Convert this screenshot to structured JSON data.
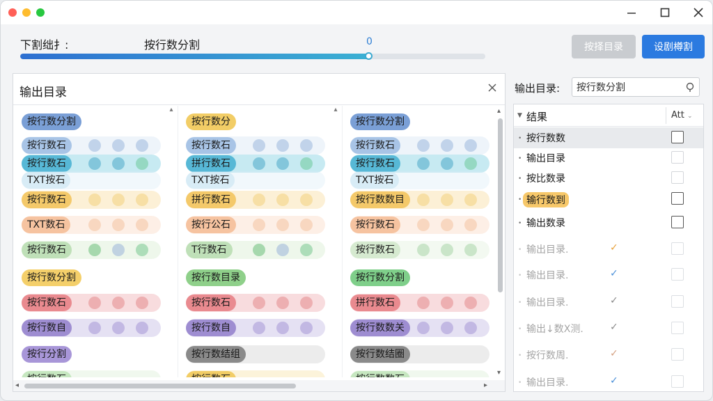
{
  "window": {
    "controls": [
      "close",
      "minimize",
      "zoom"
    ]
  },
  "top": {
    "label": "下割绌扌:",
    "value": "按行数分割",
    "percent": "0",
    "progress_fraction": 0.75,
    "btn_disabled": "按择目录",
    "btn_primary": "设剧樽割"
  },
  "panel": {
    "title": "输出目录",
    "columns": [
      {
        "rows": [
          {
            "label": "按行数分割",
            "pill": "#7a9fd6",
            "band": null,
            "dots": []
          },
          {
            "label": "按行数石",
            "pill": "#a8c4e6",
            "band": "#cfe0f2",
            "dots": [
              "#9cb8dc",
              "#9cb8dc",
              "#9cb8dc"
            ]
          },
          {
            "label": "按行数石",
            "pill": "#57b8d6",
            "band": "#5fc2db",
            "dots": [
              "#4aa8c8",
              "#4aa8c8",
              "#6cc99a"
            ]
          },
          {
            "label": "TXT按石",
            "pill": "#d8ecf6",
            "band": "#d6ebf5",
            "dots": []
          },
          {
            "label": "按行数石",
            "pill": "#f4c96a",
            "band": "#f7d58a",
            "dots": [
              "#f3d27d",
              "#f3d27d",
              "#f3d27d"
            ]
          },
          {
            "label": "TXT数石",
            "pill": "#f6c3a0",
            "band": "#f8d2b8",
            "dots": [
              "#f4c3a0",
              "#f4c3a0",
              "#f4c3a0"
            ]
          },
          {
            "label": "按行数石",
            "pill": "#bfe0b8",
            "band": "#cfe8c6",
            "dots": [
              "#6cc07a",
              "#9ab4d8",
              "#78c890"
            ]
          },
          {
            "label": "按行数分割",
            "pill": "#f4cf6a",
            "band": null,
            "dots": []
          },
          {
            "label": "按行数石",
            "pill": "#e98a8f",
            "band": "#eb9aa0",
            "dots": [
              "#e48a8c",
              "#e48a8c",
              "#e48a8c"
            ]
          },
          {
            "label": "按行数自",
            "pill": "#9e8dd1",
            "band": "#b5a8dc",
            "dots": [
              "#a597d6",
              "#a597d6",
              "#a597d6"
            ]
          },
          {
            "label": "按行分割",
            "pill": "#a896d8",
            "band": null,
            "dots": []
          },
          {
            "label": "按行数石",
            "pill": "#c6e7c0",
            "band": "#d4eccf",
            "dots": []
          }
        ]
      },
      {
        "rows": [
          {
            "label": "按行数分",
            "pill": "#f2cd66",
            "band": null,
            "dots": []
          },
          {
            "label": "按行数石",
            "pill": "#a8c4e6",
            "band": "#cfe0f2",
            "dots": [
              "#9cb8dc",
              "#9cb8dc",
              "#9cb8dc"
            ]
          },
          {
            "label": "拼行数石",
            "pill": "#57b8d6",
            "band": "#5fc2db",
            "dots": [
              "#4aa8c8",
              "#4aa8c8",
              "#6cc99a"
            ]
          },
          {
            "label": "TXT按石",
            "pill": "#d8ecf6",
            "band": "#d6ebf5",
            "dots": []
          },
          {
            "label": "拼行数石",
            "pill": "#f4c96a",
            "band": "#f7d58a",
            "dots": [
              "#f3d27d",
              "#f3d27d",
              "#f3d27d"
            ]
          },
          {
            "label": "按行公石",
            "pill": "#f6c3a0",
            "band": "#f8d2b8",
            "dots": [
              "#f4c3a0",
              "#f4c3a0",
              "#f4c3a0"
            ]
          },
          {
            "label": "T行数石",
            "pill": "#bfe0b8",
            "band": "#cfe8c6",
            "dots": [
              "#6cc07a",
              "#9ab4d8",
              "#78c890"
            ]
          },
          {
            "label": "按行数目录",
            "pill": "#8fd08a",
            "band": null,
            "dots": []
          },
          {
            "label": "按行数石",
            "pill": "#e98a8f",
            "band": "#eb9aa0",
            "dots": [
              "#e48a8c",
              "#e48a8c",
              "#e48a8c"
            ]
          },
          {
            "label": "按行数自",
            "pill": "#9e8dd1",
            "band": "#b5a8dc",
            "dots": [
              "#a597d6",
              "#a597d6",
              "#a597d6"
            ]
          },
          {
            "label": "按行数结组",
            "pill": "#8a8a8a",
            "band": "#c8c8c8",
            "dots": []
          },
          {
            "label": "按行数石",
            "pill": "#f2cd66",
            "band": "#f5dc96",
            "dots": []
          }
        ]
      },
      {
        "rows": [
          {
            "label": "按行数分割",
            "pill": "#7a9fd6",
            "band": null,
            "dots": []
          },
          {
            "label": "按行数石",
            "pill": "#a8c4e6",
            "band": "#cfe0f2",
            "dots": [
              "#9cb8dc",
              "#9cb8dc",
              "#9cb8dc"
            ]
          },
          {
            "label": "按行数石",
            "pill": "#57b8d6",
            "band": "#5fc2db",
            "dots": [
              "#4aa8c8",
              "#4aa8c8",
              "#6cc99a"
            ]
          },
          {
            "label": "TXT按石",
            "pill": "#d8ecf6",
            "band": "#d6ebf5",
            "dots": []
          },
          {
            "label": "按行数数目",
            "pill": "#f4c96a",
            "band": "#f7d58a",
            "dots": [
              "#f3d27d",
              "#f3d27d",
              "#f3d27d"
            ]
          },
          {
            "label": "按行数石",
            "pill": "#f6c3a0",
            "band": "#f8d2b8",
            "dots": [
              "#f4c3a0",
              "#f4c3a0",
              "#f4c3a0"
            ]
          },
          {
            "label": "按行数石",
            "pill": "#d6ead0",
            "band": "#dcedd6",
            "dots": [
              "#a8d6a8",
              "#a8d6a8",
              "#a8d6a8"
            ]
          },
          {
            "label": "按行数分割",
            "pill": "#7fcf8a",
            "band": null,
            "dots": []
          },
          {
            "label": "拼行数石",
            "pill": "#e98a8f",
            "band": "#eb9aa0",
            "dots": [
              "#e48a8c",
              "#e48a8c",
              "#e48a8c"
            ]
          },
          {
            "label": "按行数数关",
            "pill": "#9e8dd1",
            "band": "#b5a8dc",
            "dots": [
              "#a597d6",
              "#a597d6",
              "#a597d6"
            ]
          },
          {
            "label": "按行数结圈",
            "pill": "#8a8a8a",
            "band": "#c8c8c8",
            "dots": []
          },
          {
            "label": "按行数数石",
            "pill": "#c6e7c0",
            "band": "#d4eccf",
            "dots": []
          }
        ]
      }
    ]
  },
  "right": {
    "label": "输出目录:",
    "search_value": "按行数分割",
    "tree_header": "结果",
    "col2_header": "Att",
    "rows": [
      {
        "text": "按行数数",
        "mark": "",
        "mark_color": "",
        "checked": false,
        "state": "selected"
      },
      {
        "text": "输出目录",
        "mark": "",
        "mark_color": "",
        "checked": false,
        "state": "light"
      },
      {
        "text": "按比数录",
        "mark": "",
        "mark_color": "",
        "checked": false,
        "state": "light"
      },
      {
        "text": "输行数到",
        "mark": "",
        "mark_color": "",
        "checked": false,
        "state": "highlight"
      },
      {
        "text": "输出数录",
        "mark": "",
        "mark_color": "",
        "checked": false,
        "state": "normal"
      },
      {
        "text": "输出目录.",
        "mark": "✓",
        "mark_color": "#e8a23c",
        "checked": false,
        "state": "faded"
      },
      {
        "text": "输出目录.",
        "mark": "✓",
        "mark_color": "#4a90d9",
        "checked": false,
        "state": "faded"
      },
      {
        "text": "输出目录.",
        "mark": "✓",
        "mark_color": "#8a8a8a",
        "checked": false,
        "state": "faded"
      },
      {
        "text": "输出↓数X测.",
        "mark": "✓",
        "mark_color": "#8a8a8a",
        "checked": false,
        "state": "faded"
      },
      {
        "text": "按行数周.",
        "mark": "✓",
        "mark_color": "#d4a080",
        "checked": false,
        "state": "faded"
      },
      {
        "text": "输出目录.",
        "mark": "✓",
        "mark_color": "#4a90d9",
        "checked": false,
        "state": "faded"
      }
    ]
  },
  "colors": {
    "accent": "#2b7ae0",
    "disabled": "#c9ccd0"
  }
}
